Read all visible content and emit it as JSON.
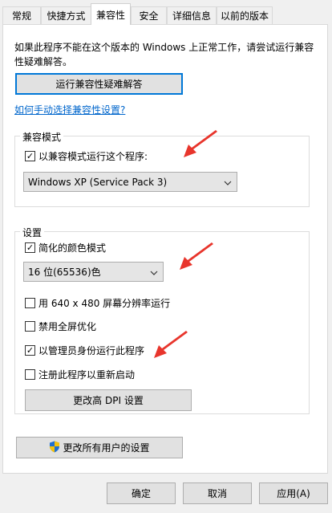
{
  "tabs": [
    "常规",
    "快捷方式",
    "兼容性",
    "安全",
    "详细信息",
    "以前的版本"
  ],
  "intro_text": "如果此程序不能在这个版本的 Windows 上正常工作，请尝试运行兼容性疑难解答。",
  "troubleshooter_button": "运行兼容性疑难解答",
  "manual_link": "如何手动选择兼容性设置?",
  "compat_group": {
    "title": "兼容模式",
    "checkbox_label": "以兼容模式运行这个程序:",
    "checked": true,
    "select_value": "Windows XP (Service Pack 3)"
  },
  "settings_group": {
    "title": "设置",
    "reduced_color": {
      "label": "简化的颜色模式",
      "checked": true
    },
    "color_select_value": "16 位(65536)色",
    "res_640": {
      "label": "用 640 x 480 屏幕分辨率运行",
      "checked": false
    },
    "disable_fullscreen": {
      "label": "禁用全屏优化",
      "checked": false
    },
    "run_as_admin": {
      "label": "以管理员身份运行此程序",
      "checked": true
    },
    "register_restart": {
      "label": "注册此程序以重新启动",
      "checked": false
    },
    "dpi_button": "更改高 DPI 设置"
  },
  "all_users_button": "更改所有用户的设置",
  "footer": {
    "ok": "确定",
    "cancel": "取消",
    "apply": "应用(A)"
  },
  "colors": {
    "arrow": "#e8352c",
    "link": "#0066cc",
    "focus": "#0078d7"
  }
}
